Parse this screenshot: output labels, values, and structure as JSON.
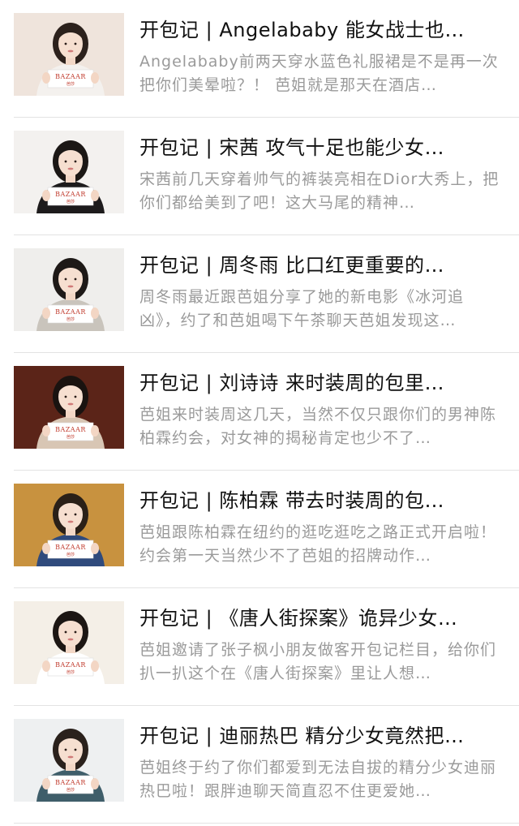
{
  "articles": [
    {
      "title": "开包记 | Angelababy 能女战士也…",
      "desc": "Angelababy前两天穿水蓝色礼服裙是不是再一次把你们美晕啦？！ 芭姐就是那天在酒店…",
      "thumb_sign": "BAZAAR",
      "thumb_sign_sub": "芭莎",
      "bg": "#efe4dc",
      "hair": "#2c211c",
      "cloth": "#f4f1ee"
    },
    {
      "title": "开包记 | 宋茜 攻气十足也能少女…",
      "desc": "宋茜前几天穿着帅气的裤装亮相在Dior大秀上，把你们都给美到了吧！这大马尾的精神…",
      "thumb_sign": "BAZAAR",
      "thumb_sign_sub": "芭莎",
      "bg": "#f3f1ef",
      "hair": "#1b1715",
      "cloth": "#1d1b1c"
    },
    {
      "title": "开包记 | 周冬雨 比口红更重要的…",
      "desc": "周冬雨最近跟芭姐分享了她的新电影《冰河追凶》，约了和芭姐喝下午茶聊天芭姐发现这…",
      "thumb_sign": "BAZAAR",
      "thumb_sign_sub": "芭莎",
      "bg": "#efeeec",
      "hair": "#1e1917",
      "cloth": "#c9c4bc"
    },
    {
      "title": "开包记 | 刘诗诗 来时装周的包里…",
      "desc": "芭姐来时装周这几天，当然不仅只跟你们的男神陈柏霖约会，对女神的揭秘肯定也少不了…",
      "thumb_sign": "BAZAAR",
      "thumb_sign_sub": "芭莎",
      "bg": "#5b2418",
      "hair": "#1a1310",
      "cloth": "#d8c6b4"
    },
    {
      "title": "开包记 | 陈柏霖 带去时装周的包…",
      "desc": "芭姐跟陈柏霖在纽约的逛吃逛吃之路正式开启啦！约会第一天当然少不了芭姐的招牌动作…",
      "thumb_sign": "BAZAAR",
      "thumb_sign_sub": "芭莎",
      "bg": "#c8923f",
      "hair": "#2a2018",
      "cloth": "#2f4a7c"
    },
    {
      "title": "开包记 | 《唐人街探案》诡异少女…",
      "desc": "芭姐邀请了张子枫小朋友做客开包记栏目，给你们扒一扒这个在《唐人街探案》里让人想…",
      "thumb_sign": "BAZAAR",
      "thumb_sign_sub": "芭莎",
      "bg": "#f4efe7",
      "hair": "#1c1613",
      "cloth": "#ffffff"
    },
    {
      "title": "开包记 | 迪丽热巴 精分少女竟然把…",
      "desc": "芭姐终于约了你们都爱到无法自拔的精分少女迪丽热巴啦！跟胖迪聊天简直忍不住更爱她…",
      "thumb_sign": "BAZAAR",
      "thumb_sign_sub": "芭莎",
      "bg": "#eef0f1",
      "hair": "#2a211c",
      "cloth": "#3f5e6a"
    }
  ]
}
